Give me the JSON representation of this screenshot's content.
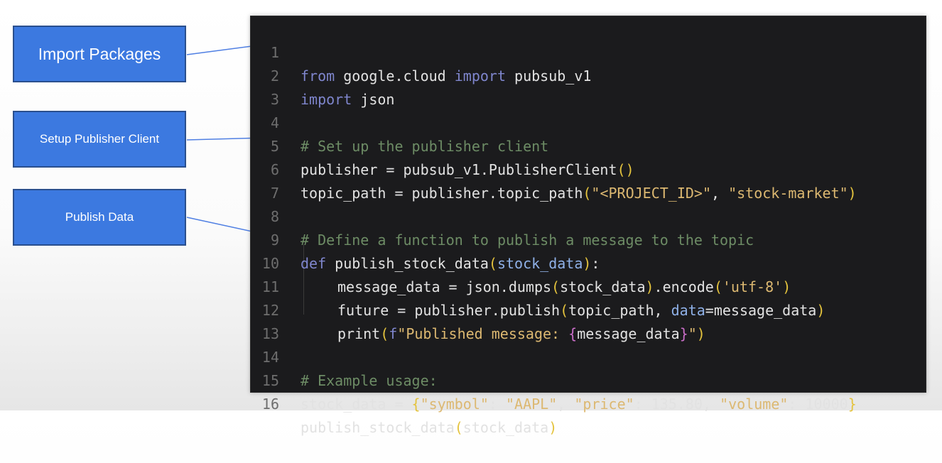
{
  "labels": {
    "import_packages": "Import Packages",
    "setup_publisher_client": "Setup Publisher Client",
    "publish_data": "Publish Data"
  },
  "colors": {
    "box_fill": "#3c79e0",
    "box_border": "#2a4f8e",
    "arrow": "#4f7fe3",
    "code_background": "#1b1b1d"
  },
  "code": {
    "line_numbers": [
      "1",
      "2",
      "3",
      "4",
      "5",
      "6",
      "7",
      "8",
      "9",
      "10",
      "11",
      "12",
      "13",
      "14",
      "15",
      "16"
    ],
    "l1": {
      "from": "from",
      "mod": " google.cloud ",
      "import": "import",
      "name": " pubsub_v1"
    },
    "l2": {
      "import": "import",
      "name": " json"
    },
    "l4": {
      "comment": "# Set up the publisher client"
    },
    "l5": {
      "lhs": "publisher = pubsub_v1.PublisherClient",
      "open": "(",
      "close": ")"
    },
    "l6": {
      "lhs": "topic_path = publisher.topic_path",
      "open": "(",
      "arg1": "\"<PROJECT_ID>\"",
      "sep": ", ",
      "arg2": "\"stock-market\"",
      "close": ")"
    },
    "l8": {
      "comment": "# Define a function to publish a message to the topic"
    },
    "l9": {
      "def": "def",
      "name": " publish_stock_data",
      "open": "(",
      "param": "stock_data",
      "close": ")",
      "colon": ":"
    },
    "l10": {
      "lhs": "message_data = json.dumps",
      "open": "(",
      "arg": "stock_data",
      "close": ")",
      "method": ".encode",
      "open2": "(",
      "str": "'utf-8'",
      "close2": ")"
    },
    "l11": {
      "lhs": "future = publisher.publish",
      "open": "(",
      "arg": "topic_path, ",
      "kwarg": "data",
      "val": "=message_data",
      "close": ")"
    },
    "l12": {
      "func": "print",
      "open": "(",
      "fpre": "f",
      "str": "\"Published message: ",
      "bopen": "{",
      "var": "message_data",
      "bclose": "}",
      "strend": "\"",
      "close": ")"
    },
    "l14": {
      "comment": "# Example usage:"
    },
    "l15": {
      "lhs": "stock_data = ",
      "bopen": "{",
      "k1": "\"symbol\"",
      "c1": ": ",
      "v1": "\"AAPL\"",
      "s1": ", ",
      "k2": "\"price\"",
      "c2": ": 135.80, ",
      "k3": "\"volume\"",
      "c3": ": 10000",
      "bclose": "}"
    },
    "l16": {
      "func": "publish_stock_data",
      "open": "(",
      "arg": "stock_data",
      "close": ")"
    }
  }
}
